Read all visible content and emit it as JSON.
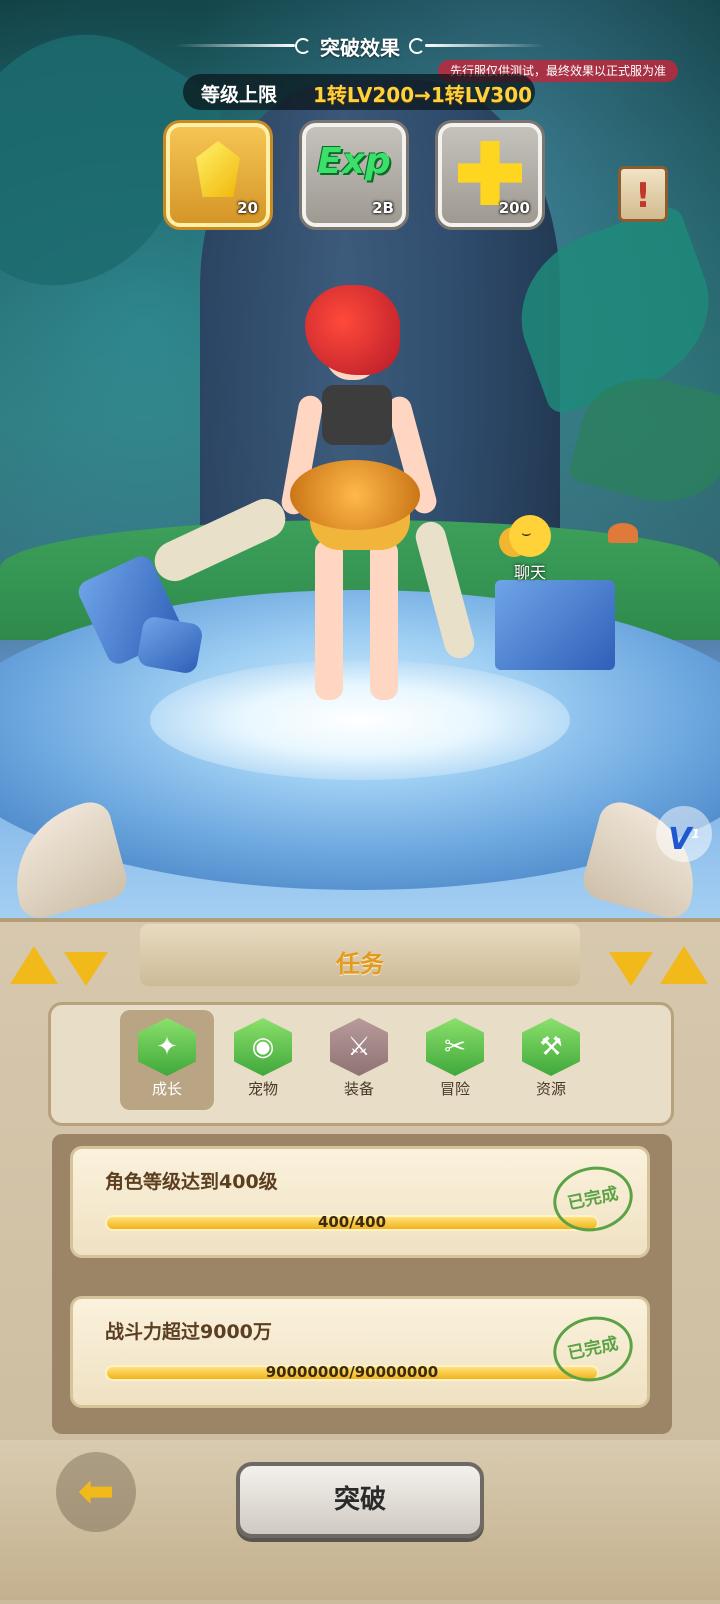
{
  "header": {
    "title": "突破效果",
    "test_note": "先行服仅供测试，最终效果以正式服为准",
    "level_cap_label": "等级上限",
    "level_cap_value": "1转LV200→1转LV300"
  },
  "rewards": [
    {
      "icon": "gold-crystal-icon",
      "count": "20"
    },
    {
      "icon": "exp-icon",
      "label": "Exp",
      "count": "2B"
    },
    {
      "icon": "gold-plus-icon",
      "count": "200"
    }
  ],
  "scene": {
    "chat_label": "聊天",
    "info_icon": "!",
    "v_badge": "V",
    "v_badge_sup": "1"
  },
  "panel": {
    "title": "任务",
    "tabs": [
      {
        "label": "成长",
        "icon": "growth-icon",
        "active": true
      },
      {
        "label": "宠物",
        "icon": "pet-icon"
      },
      {
        "label": "装备",
        "icon": "equipment-icon",
        "locked": true
      },
      {
        "label": "冒险",
        "icon": "adventure-icon"
      },
      {
        "label": "资源",
        "icon": "resource-icon"
      }
    ],
    "tasks": [
      {
        "title": "角色等级达到400级",
        "progress_text": "400/400",
        "progress": 1.0,
        "status": "已完成"
      },
      {
        "title": "战斗力超过9000万",
        "progress_text": "90000000/90000000",
        "progress": 1.0,
        "status": "已完成"
      }
    ],
    "action_button": "突破"
  },
  "colors": {
    "accent_gold": "#f2b91b",
    "title_orange": "#e39b1e",
    "complete_green": "#5ba245",
    "test_note_red": "#be283c"
  }
}
